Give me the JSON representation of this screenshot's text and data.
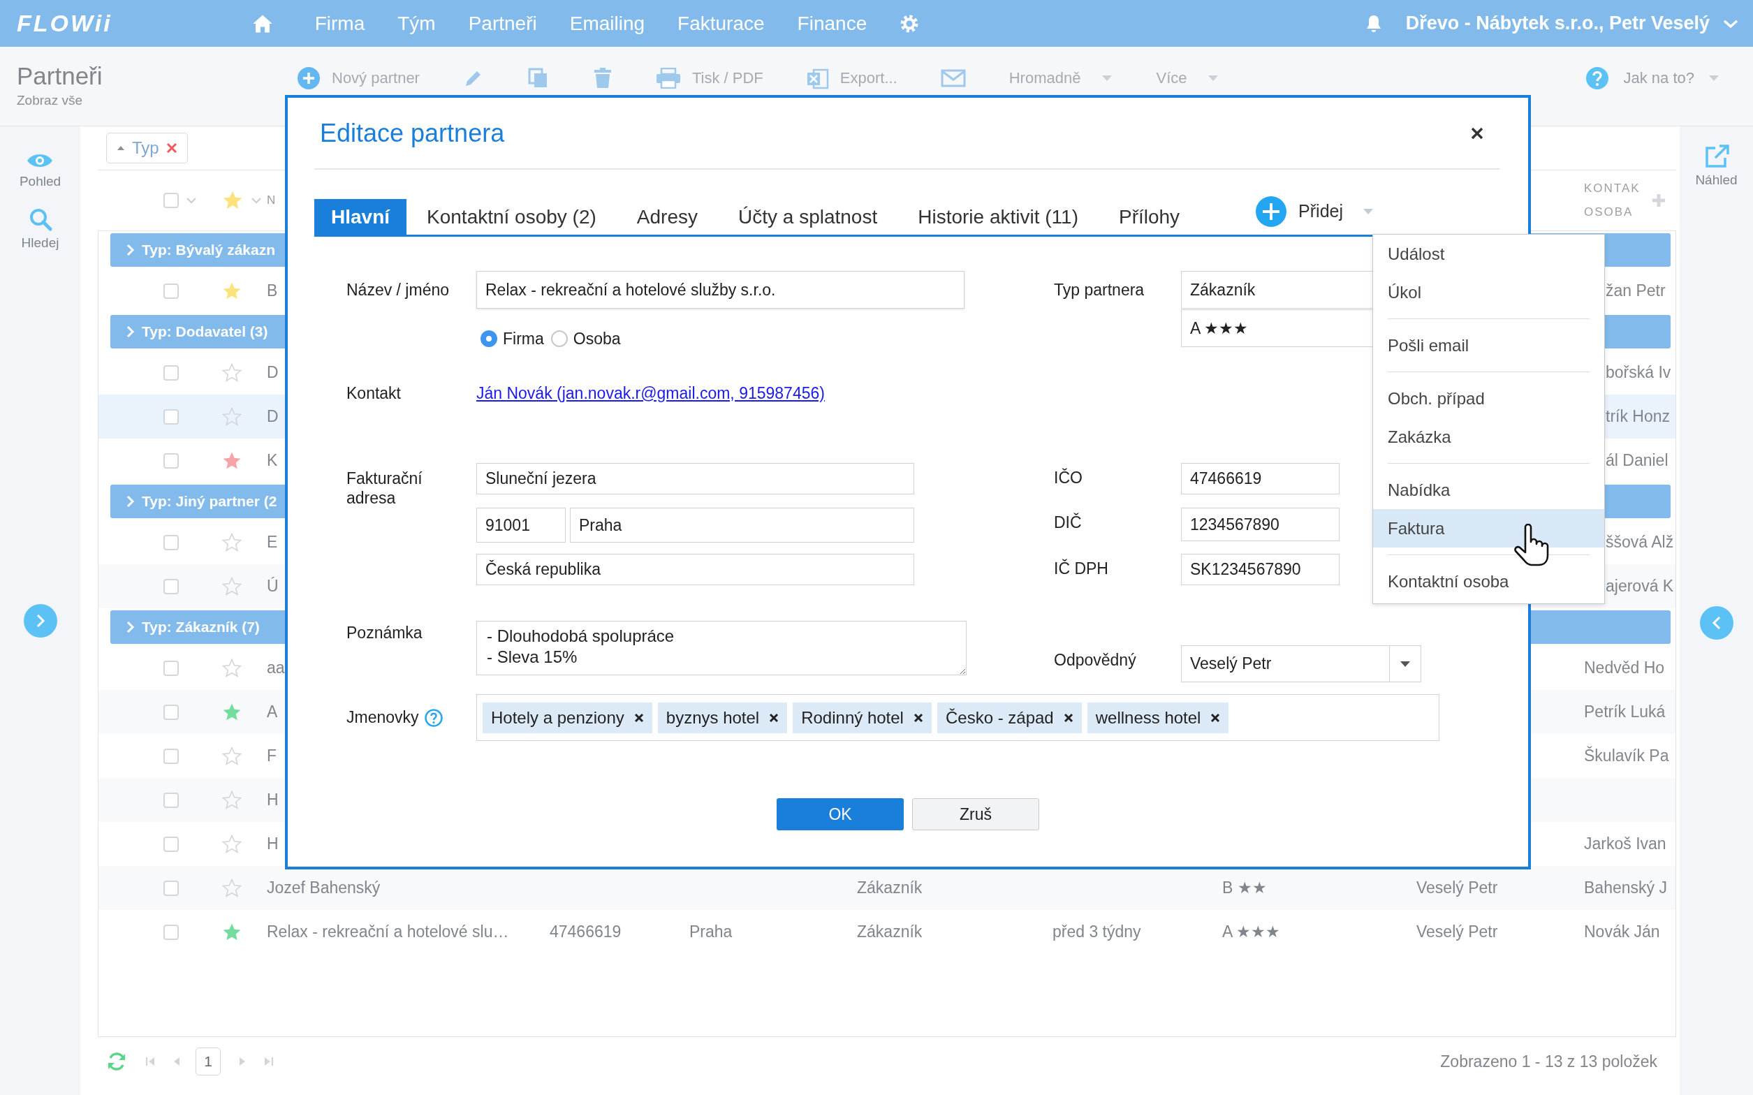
{
  "app": {
    "logo": "FLOWii",
    "nav": [
      "Firma",
      "Tým",
      "Partneři",
      "Emailing",
      "Fakturace",
      "Finance"
    ],
    "account": "Dřevo - Nábytek s.r.o., Petr Veselý"
  },
  "page": {
    "title": "Partneři",
    "subtitle": "Zobraz vše"
  },
  "toolbar": [
    {
      "kind": "add",
      "label": "Nový partner"
    },
    {
      "kind": "edit"
    },
    {
      "kind": "copy"
    },
    {
      "kind": "delete"
    },
    {
      "kind": "print",
      "label": "Tisk / PDF"
    },
    {
      "kind": "export",
      "label": "Export..."
    },
    {
      "kind": "mail"
    },
    {
      "kind": "menu",
      "label": "Hromadně"
    },
    {
      "kind": "menu",
      "label": "Více"
    }
  ],
  "help": "Jak na to?",
  "left_sidebar": [
    {
      "kind": "view",
      "label": "Pohled"
    },
    {
      "kind": "search",
      "label": "Hledej"
    }
  ],
  "right_sidebar": {
    "label": "Náhled"
  },
  "filter_chip": "Typ",
  "table": {
    "select_all_checked": false,
    "columns": [
      "N",
      "KONTAK OSOBA"
    ],
    "rows": [
      {
        "kind": "group",
        "label": "Typ: Bývalý zákazn"
      },
      {
        "kind": "row_under_menu",
        "checked": false,
        "starred": true,
        "color": "#fde27c",
        "hovered": false,
        "name": "B",
        "contact": "žan Petr"
      },
      {
        "kind": "group",
        "label": "Typ: Dodavatel (3)"
      },
      {
        "kind": "row_under_menu",
        "checked": false,
        "starred": false,
        "hovered": false,
        "name": "D",
        "contact": "bořská Iv"
      },
      {
        "kind": "row_under_menu",
        "checked": false,
        "starred": false,
        "hovered": true,
        "name": "D",
        "contact": "trík Honz"
      },
      {
        "kind": "row_under_menu",
        "checked": false,
        "starred": true,
        "color": "#f8a3a9",
        "hovered": false,
        "name": "K",
        "contact": "ál Daniel"
      },
      {
        "kind": "group",
        "label": "Typ: Jiný partner (2"
      },
      {
        "kind": "row_under_menu",
        "checked": false,
        "starred": false,
        "hovered": false,
        "name": "E",
        "contact": "ššová Alž"
      },
      {
        "kind": "row_under_menu",
        "checked": false,
        "starred": false,
        "hovered": false,
        "name": "Ú",
        "contact": "ajerová K"
      },
      {
        "kind": "group",
        "label": "Typ: Zákazník (7)"
      },
      {
        "kind": "row",
        "checked": false,
        "starred": false,
        "hovered": false,
        "name": "aa",
        "contact": "Nedvěd Ho"
      },
      {
        "kind": "row",
        "checked": false,
        "starred": true,
        "color": "#72dd9c",
        "hovered": false,
        "name": "A",
        "contact": "Petrík Luká"
      },
      {
        "kind": "row",
        "checked": false,
        "starred": false,
        "hovered": false,
        "name": "F",
        "contact": "Škulavík Pa"
      },
      {
        "kind": "row",
        "checked": false,
        "starred": false,
        "hovered": false,
        "name": "H"
      },
      {
        "kind": "row",
        "checked": false,
        "starred": false,
        "hovered": false,
        "name": "H",
        "contact": "Jarkoš Ivan"
      },
      {
        "kind": "row",
        "checked": false,
        "starred": false,
        "hovered": false,
        "name": "Jozef Bahenský",
        "type": "Zákazník",
        "rating": "B ★★",
        "owner": "Veselý Petr",
        "contact": "Bahenský J"
      },
      {
        "kind": "row",
        "checked": false,
        "starred": true,
        "color": "#72dd9c",
        "hovered": false,
        "name": "Relax - rekreační a hotelové slu…",
        "ico": "47466619",
        "city": "Praha",
        "type": "Zákazník",
        "activity": "před 3 týdny",
        "rating": "A ★★★",
        "owner": "Veselý Petr",
        "contact": "Novák Ján"
      }
    ]
  },
  "pagination": {
    "page": "1",
    "summary": "Zobrazeno 1 - 13 z 13 položek"
  },
  "dialog": {
    "title": "Editace partnera",
    "tabs": [
      {
        "label": "Hlavní",
        "selected": true
      },
      {
        "label": "Kontaktní osoby (2)",
        "selected": false
      },
      {
        "label": "Adresy",
        "selected": false
      },
      {
        "label": "Účty a splatnost",
        "selected": false
      },
      {
        "label": "Historie aktivit (11)",
        "selected": false
      },
      {
        "label": "Přílohy",
        "selected": false
      }
    ],
    "add_button": "Přidej",
    "form": {
      "name_label": "Název / jméno",
      "name": "Relax - rekreační a hotelové služby s.r.o.",
      "entity_types": [
        {
          "label": "Firma",
          "selected": true
        },
        {
          "label": "Osoba",
          "selected": false
        }
      ],
      "contact_label": "Kontakt",
      "contact": "Ján Novák (jan.novak.r@gmail.com, 915987456)",
      "address_label": "Fakturační adresa",
      "street": "Sluneční jezera",
      "zip": "91001",
      "city": "Praha",
      "country": "Česká republika",
      "note_label": "Poznámka",
      "note": "- Dlouhodobá spolupráce\n- Sleva 15%",
      "tags_label": "Jmenovky",
      "tags": [
        "Hotely a penziony",
        "byznys hotel",
        "Rodinný hotel",
        "Česko - západ",
        "wellness hotel"
      ],
      "type_label": "Typ partnera",
      "type": "Zákazník",
      "rating": "A ★★★",
      "ico_label": "IČO",
      "ico": "47466619",
      "dic_label": "DIČ",
      "dic": "1234567890",
      "icdph_label": "IČ DPH",
      "icdph": "SK1234567890",
      "owner_label": "Odpovědný",
      "owner": "Veselý Petr"
    },
    "buttons": [
      {
        "kind": "primary",
        "label": "OK"
      },
      {
        "kind": "secondary",
        "label": "Zruš"
      }
    ]
  },
  "add_menu": [
    {
      "label": "Událost",
      "divider_before": false,
      "highlighted": false
    },
    {
      "label": "Úkol",
      "divider_before": false,
      "highlighted": false
    },
    {
      "label": "Pošli email",
      "divider_before": true,
      "highlighted": false
    },
    {
      "label": "Obch. případ",
      "divider_before": true,
      "highlighted": false
    },
    {
      "label": "Zakázka",
      "divider_before": false,
      "highlighted": false
    },
    {
      "label": "Nabídka",
      "divider_before": true,
      "highlighted": false
    },
    {
      "label": "Faktura",
      "divider_before": false,
      "highlighted": true
    },
    {
      "label": "Kontaktní osoba",
      "divider_before": true,
      "highlighted": false
    }
  ]
}
